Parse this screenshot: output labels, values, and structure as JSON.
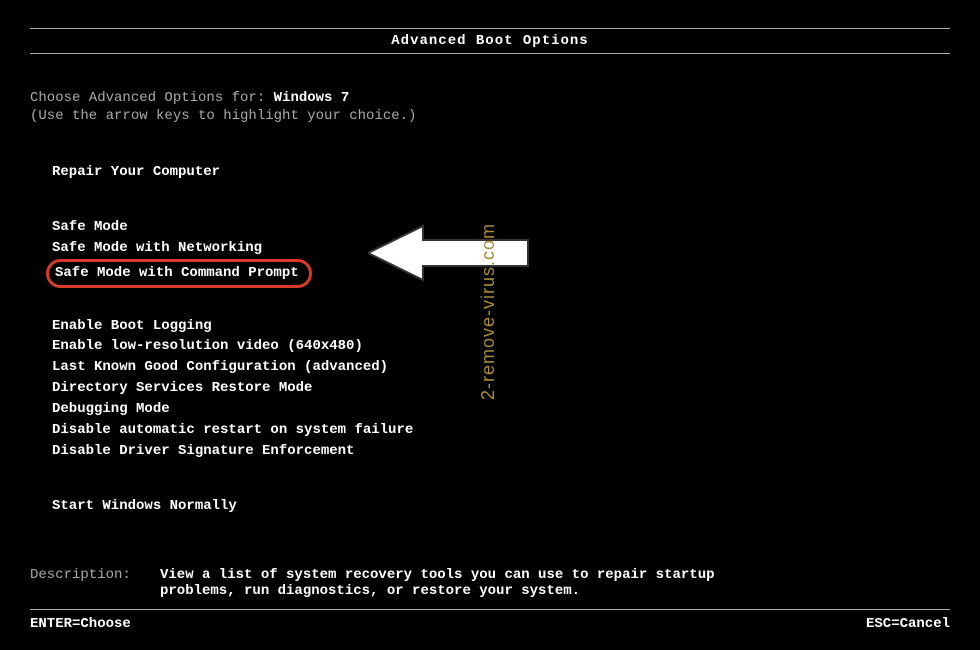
{
  "title": "Advanced Boot Options",
  "choose_prefix": "Choose Advanced Options for: ",
  "os_name": "Windows 7",
  "hint": "(Use the arrow keys to highlight your choice.)",
  "groups": [
    {
      "items": [
        "Repair Your Computer"
      ]
    },
    {
      "items": [
        "Safe Mode",
        "Safe Mode with Networking",
        "Safe Mode with Command Prompt"
      ],
      "highlighted_index": 2
    },
    {
      "items": [
        "Enable Boot Logging",
        "Enable low-resolution video (640x480)",
        "Last Known Good Configuration (advanced)",
        "Directory Services Restore Mode",
        "Debugging Mode",
        "Disable automatic restart on system failure",
        "Disable Driver Signature Enforcement"
      ]
    },
    {
      "items": [
        "Start Windows Normally"
      ]
    }
  ],
  "description_label": "Description:",
  "description_text": "View a list of system recovery tools you can use to repair startup problems, run diagnostics, or restore your system.",
  "footer": {
    "enter": "ENTER=Choose",
    "esc": "ESC=Cancel"
  },
  "watermark": "2-remove-virus.com"
}
